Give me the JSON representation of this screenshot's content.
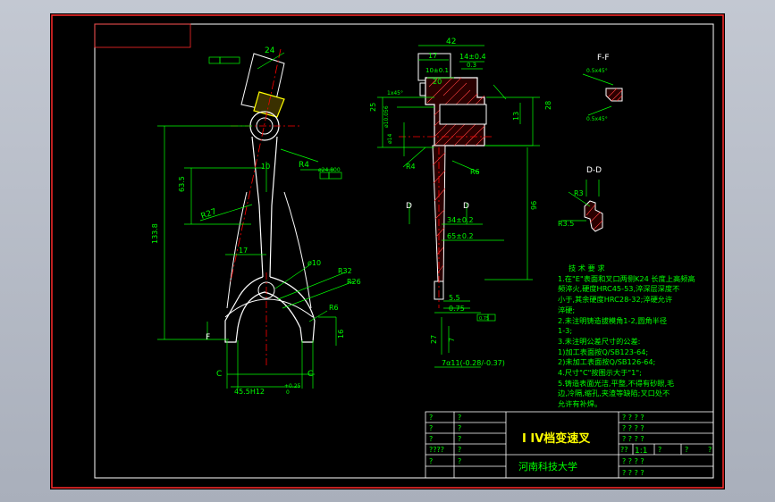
{
  "title_block": {
    "part_name": "I IV档变速叉",
    "school": "河南科技大学",
    "scale": "1:1",
    "cells": [
      "?",
      "?",
      "?",
      "?",
      "?",
      "?",
      "????",
      "?",
      "?",
      "?",
      "? ? ? ?",
      "? ? ? ?",
      "? ? ? ?",
      "? ? ? ?",
      "? ? ? ?",
      "??",
      "?",
      "?",
      "?"
    ]
  },
  "views": {
    "section_ff": "F-F",
    "section_dd": "D-D",
    "label_d": "D",
    "label_f": "F"
  },
  "dimensions": {
    "front": [
      "24",
      "10",
      "R4",
      "63.5",
      "133.8",
      "R27",
      "17",
      "ø10",
      "R32",
      "R26",
      "R6",
      "16",
      "C",
      "C",
      "45.5H12",
      "+0.25",
      "0",
      "ø24.800"
    ],
    "side": [
      "42",
      "17",
      "14±0.4",
      "10±0.1",
      "0.3",
      "20",
      "25",
      "28",
      "13",
      "ø10.056",
      "ø14",
      "1x45°",
      "R4",
      "R6",
      "96",
      "34±0.2",
      "65±0.2",
      "5.5",
      "0.75",
      "0.75",
      "27",
      "7",
      "7α11(-0.28/-0.37)"
    ],
    "section_ff": [
      "0.5x45°",
      "0.5x45°"
    ],
    "section_dd": [
      "R3",
      "R3.5"
    ]
  },
  "notes": {
    "heading": "技 术 要 求",
    "lines": [
      "1.在\"E\"表面和叉口两侧K24 长度上高频高",
      "频淬火,硬度HRC45-53,淬深层深度不",
      "小于,其余硬度HRC28-32;淬硬允许",
      "淬硬;",
      "2.未注明铸造拔模角1-2,圆角半径",
      "1-3;",
      "3.未注明公差尺寸的公差:",
      "  1)加工表面按Q/SB123-64;",
      "  2)未加工表面按Q/SB126-64;",
      "4.尺寸\"C\"按图示大于\"1\";",
      "5.铸造表面光洁,平整,不得有砂眼,毛",
      "边,冷隔,缩孔,夹渣等缺陷;叉口处不",
      "允许有补焊。"
    ]
  },
  "colors": {
    "outline": "#ffffff",
    "dimension": "#00ff00",
    "centerline": "#ff0000",
    "hatch": "#ff4040",
    "part": "#ffff00",
    "sheet": "#000000"
  }
}
